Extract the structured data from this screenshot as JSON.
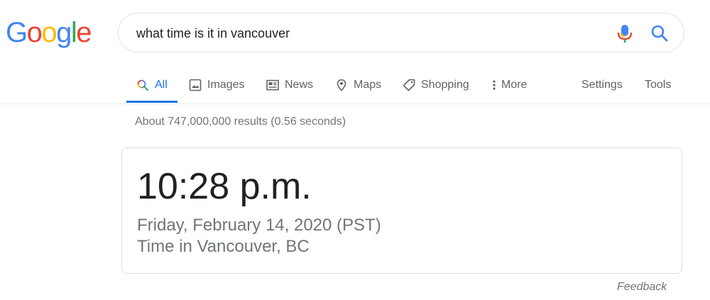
{
  "logo": {
    "letters": [
      "G",
      "o",
      "o",
      "g",
      "l",
      "e"
    ],
    "colors": [
      "#4285F4",
      "#EA4335",
      "#FBBC05",
      "#4285F4",
      "#34A853",
      "#EA4335"
    ]
  },
  "search": {
    "query": "what time is it in vancouver",
    "mic_icon": "mic-icon",
    "search_icon": "search-icon"
  },
  "tabs": [
    {
      "label": "All",
      "icon": "search-icon",
      "active": true
    },
    {
      "label": "Images",
      "icon": "image-icon"
    },
    {
      "label": "News",
      "icon": "news-icon"
    },
    {
      "label": "Maps",
      "icon": "map-pin-icon"
    },
    {
      "label": "Shopping",
      "icon": "tag-icon"
    },
    {
      "label": "More",
      "icon": "more-vert-icon"
    },
    {
      "label": "Settings"
    },
    {
      "label": "Tools"
    }
  ],
  "results": {
    "stats": "About 747,000,000 results (0.56 seconds)"
  },
  "time_card": {
    "time": "10:28 p.m.",
    "date": "Friday, February 14, 2020 (PST)",
    "location": "Time in Vancouver, BC"
  },
  "feedback_label": "Feedback",
  "colors": {
    "accent": "#1a73e8",
    "muted": "#70757a",
    "border": "#dadce0"
  }
}
